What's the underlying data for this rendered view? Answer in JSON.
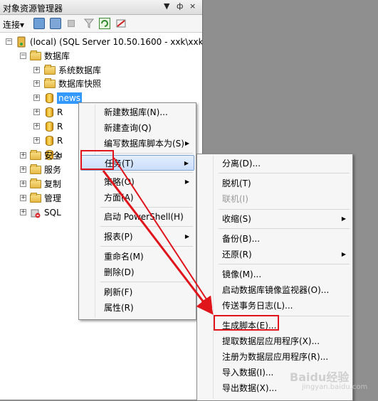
{
  "panel": {
    "title": "对象资源管理器",
    "title_controls": [
      "▼",
      "ф",
      "×"
    ],
    "toolbar": {
      "connect_label": "连接",
      "connect_dropdown": "▾"
    }
  },
  "tree": {
    "server": "(local) (SQL Server 10.50.1600 - xxk\\xxk0",
    "databases_folder": "数据库",
    "system_databases": "系统数据库",
    "database_snapshots": "数据库快照",
    "selected_db": "news",
    "hidden_db_1": "R",
    "hidden_db_2": "R",
    "hidden_db_3": "R",
    "hidden_db_4": "u",
    "security": "安全",
    "server_objects": "服务",
    "replication": "复制",
    "management": "管理",
    "sql_agent": "SQL",
    "expand_plus": "+",
    "collapse_minus": "−"
  },
  "context_menu": {
    "items": [
      {
        "label": "新建数据库(N)..."
      },
      {
        "label": "新建查询(Q)"
      },
      {
        "label": "编写数据库脚本为(S)"
      },
      {
        "label": "任务(T)"
      },
      {
        "label": "策略(O)"
      },
      {
        "label": "方面(A)"
      },
      {
        "label": "启动 PowerShell(H)"
      },
      {
        "label": "报表(P)"
      },
      {
        "label": "重命名(M)"
      },
      {
        "label": "删除(D)"
      },
      {
        "label": "刷新(F)"
      },
      {
        "label": "属性(R)"
      }
    ],
    "submenu_arrow": "▶"
  },
  "tasks_submenu": {
    "items": [
      {
        "label": "分离(D)..."
      },
      {
        "label": "脱机(T)"
      },
      {
        "label": "联机(I)"
      },
      {
        "label": "收缩(S)"
      },
      {
        "label": "备份(B)..."
      },
      {
        "label": "还原(R)"
      },
      {
        "label": "镜像(M)..."
      },
      {
        "label": "启动数据库镜像监视器(O)..."
      },
      {
        "label": "传送事务日志(L)..."
      },
      {
        "label": "生成脚本(E)..."
      },
      {
        "label": "提取数据层应用程序(X)..."
      },
      {
        "label": "注册为数据层应用程序(R)..."
      },
      {
        "label": "导入数据(I)..."
      },
      {
        "label": "导出数据(X)..."
      }
    ]
  },
  "annotation": {
    "color": "#e0141b"
  },
  "watermark": {
    "text": "Baidu经验",
    "sub": "jingyan.baidu.com"
  },
  "colors": {
    "background": "#8f8f8f",
    "highlight": "#c9ddfa",
    "selection": "#3399ff"
  }
}
